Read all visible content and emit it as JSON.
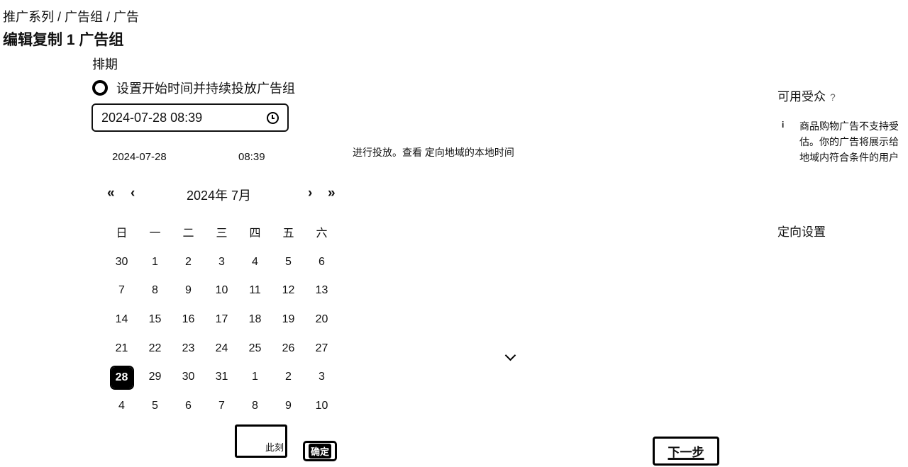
{
  "breadcrumb": "推广系列 / 广告组 / 广告",
  "page_title": "编辑复制 1 广告组",
  "schedule": {
    "section_title": "排期",
    "radio_label": "设置开始时间并持续投放广告组",
    "datetime_value": "2024-07-28 08:39",
    "icon": "clock-icon"
  },
  "picker": {
    "date": "2024-07-28",
    "time": "08:39",
    "month_label": "2024年 7月",
    "nav": {
      "prev_year": "«",
      "prev_month": "‹",
      "next_month": "›",
      "next_year": "»"
    },
    "weekdays": [
      "日",
      "一",
      "二",
      "三",
      "四",
      "五",
      "六"
    ],
    "weeks": [
      [
        "30",
        "1",
        "2",
        "3",
        "4",
        "5",
        "6"
      ],
      [
        "7",
        "8",
        "9",
        "10",
        "11",
        "12",
        "13"
      ],
      [
        "14",
        "15",
        "16",
        "17",
        "18",
        "19",
        "20"
      ],
      [
        "21",
        "22",
        "23",
        "24",
        "25",
        "26",
        "27"
      ],
      [
        "28",
        "29",
        "30",
        "31",
        "1",
        "2",
        "3"
      ],
      [
        "4",
        "5",
        "6",
        "7",
        "8",
        "9",
        "10"
      ]
    ],
    "selected_day": "28",
    "now_label": "此刻",
    "ok_label": "确定"
  },
  "notice_text": "进行投放。查看 定向地域的本地时间",
  "audience": {
    "title": "可用受众",
    "help": "?",
    "info_lines": [
      "商品购物广告不支持受",
      "估。你的广告将展示给",
      "地域内符合条件的用户"
    ]
  },
  "targeting_title": "定向设置",
  "next_label": "下一步"
}
